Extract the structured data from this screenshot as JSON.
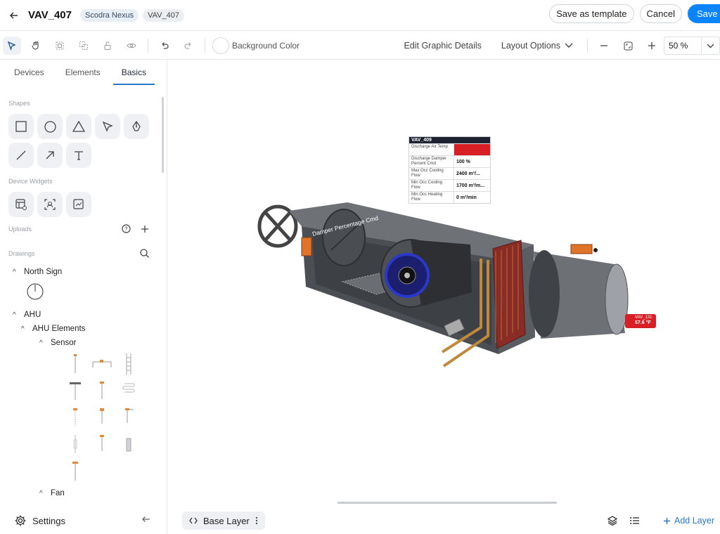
{
  "header": {
    "title": "VAV_407",
    "chips": [
      "Scodra Nexus",
      "VAV_407"
    ],
    "save_template_label": "Save as template",
    "cancel_label": "Cancel",
    "save_label": "Save"
  },
  "toolbar": {
    "background_color_label": "Background Color",
    "edit_graphic_label": "Edit Graphic Details",
    "layout_options_label": "Layout Options",
    "zoom_value": "50 %"
  },
  "sidebar": {
    "tabs": [
      "Devices",
      "Elements",
      "Basics"
    ],
    "active_tab": "Basics",
    "shapes_label": "Shapes",
    "device_widgets_label": "Device Widgets",
    "uploads_label": "Uploads",
    "drawings_label": "Drawings",
    "tree": {
      "north_sign": "North Sign",
      "ahu": "AHU",
      "ahu_elements": "AHU Elements",
      "sensor": "Sensor",
      "fan": "Fan"
    },
    "settings_label": "Settings"
  },
  "canvas": {
    "info_table": {
      "title": "VAV_409",
      "rows": [
        {
          "label": "Discharge Air Temp",
          "value": "61.6 °F",
          "alert": true
        },
        {
          "label": "Discharge Damper Percent Cmd",
          "value": "100 %",
          "alert": false
        },
        {
          "label": "Max Occ Cooling Flow",
          "value": "2400 m³/...",
          "alert": false
        },
        {
          "label": "Min Occ Cooling Flow",
          "value": "1700 m³/m...",
          "alert": false
        },
        {
          "label": "Min Occ Heating Flow",
          "value": "0 m³/min",
          "alert": false
        }
      ]
    },
    "damper_label": "Damper Percentage Cmd",
    "vav_badge": {
      "name": "VAV_131",
      "temp": "57.6 °F"
    }
  },
  "bottombar": {
    "layer_label": "Base Layer",
    "add_layer_label": "Add Layer"
  },
  "colors": {
    "accent": "#0a84ff",
    "alert": "#d81f26",
    "unit_body": "#555a60"
  }
}
